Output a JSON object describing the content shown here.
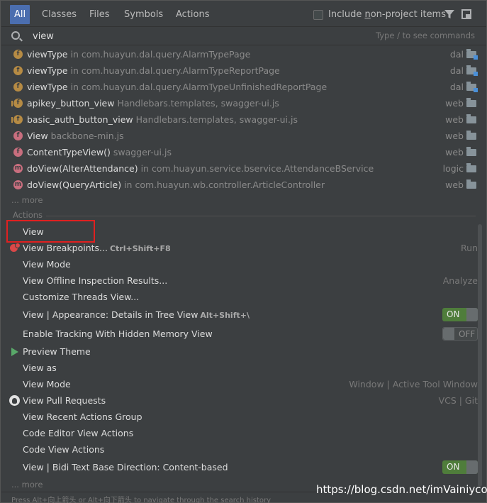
{
  "tabs": [
    {
      "label": "All",
      "active": true
    },
    {
      "label": "Classes"
    },
    {
      "label": "Files"
    },
    {
      "label": "Symbols"
    },
    {
      "label": "Actions"
    }
  ],
  "include_non_project": {
    "label_prefix": "Include ",
    "label_underlined": "n",
    "label_suffix": "on-project items",
    "checked": false
  },
  "search": {
    "value": "view",
    "hint": "Type / to see commands"
  },
  "results": [
    {
      "icon": "field",
      "name": "viewType",
      "location": "in com.huayun.dal.query.AlarmTypePage",
      "module": "dal"
    },
    {
      "icon": "field",
      "name": "viewType",
      "location": "in com.huayun.dal.query.AlarmTypeReportPage",
      "module": "dal"
    },
    {
      "icon": "field",
      "name": "viewType",
      "location": "in com.huayun.dal.query.AlarmTypeUnfinishedReportPage",
      "module": "dal"
    },
    {
      "icon": "function-local",
      "name": "apikey_button_view",
      "location": "Handlebars.templates, swagger-ui.js",
      "module": "web"
    },
    {
      "icon": "function-local",
      "name": "basic_auth_button_view",
      "location": "Handlebars.templates, swagger-ui.js",
      "module": "web"
    },
    {
      "icon": "function-param",
      "name": "View",
      "location": "backbone-min.js",
      "module": "web"
    },
    {
      "icon": "function-param",
      "name": "ContentTypeView()",
      "location": "swagger-ui.js",
      "module": "web"
    },
    {
      "icon": "method",
      "name": "doView(AlterAttendance)",
      "location": "in com.huayun.service.bservice.AttendanceBService",
      "module": "logic"
    },
    {
      "icon": "method",
      "name": "doView(QueryArticle)",
      "location": "in com.huayun.wb.controller.ArticleController",
      "module": "web"
    }
  ],
  "results_more": "... more",
  "actions_section_title": "Actions",
  "actions": [
    {
      "label": "View",
      "shortcut": "",
      "right": "",
      "icon": "",
      "toggle": ""
    },
    {
      "label": "View Breakpoints...",
      "shortcut": "Ctrl+Shift+F8",
      "right": "Run",
      "icon": "breakpoint",
      "toggle": ""
    },
    {
      "label": "View Mode",
      "shortcut": "",
      "right": "",
      "icon": "",
      "toggle": ""
    },
    {
      "label": "View Offline Inspection Results...",
      "shortcut": "",
      "right": "Analyze",
      "icon": "",
      "toggle": ""
    },
    {
      "label": "Customize Threads View...",
      "shortcut": "",
      "right": "",
      "icon": "",
      "toggle": ""
    },
    {
      "label": "View | Appearance: Details in Tree View",
      "shortcut": "Alt+Shift+\\",
      "right": "",
      "icon": "",
      "toggle": "ON"
    },
    {
      "label": "Enable Tracking With Hidden Memory View",
      "shortcut": "",
      "right": "",
      "icon": "",
      "toggle": "OFF"
    },
    {
      "label": "Preview Theme",
      "shortcut": "",
      "right": "",
      "icon": "play",
      "toggle": ""
    },
    {
      "label": "View as",
      "shortcut": "",
      "right": "",
      "icon": "",
      "toggle": ""
    },
    {
      "label": "View Mode",
      "shortcut": "",
      "right": "Window | Active Tool Window",
      "icon": "",
      "toggle": ""
    },
    {
      "label": "View Pull Requests",
      "shortcut": "",
      "right": "VCS | Git",
      "icon": "github",
      "toggle": ""
    },
    {
      "label": "View Recent Actions Group",
      "shortcut": "",
      "right": "",
      "icon": "",
      "toggle": ""
    },
    {
      "label": "Code Editor View Actions",
      "shortcut": "",
      "right": "",
      "icon": "",
      "toggle": ""
    },
    {
      "label": "Code View Actions",
      "shortcut": "",
      "right": "",
      "icon": "",
      "toggle": ""
    },
    {
      "label": "View | Bidi Text Base Direction: Content-based",
      "shortcut": "",
      "right": "",
      "icon": "",
      "toggle": "ON"
    }
  ],
  "actions_more": "... more",
  "footer_hint": "Press Alt+向上箭头 or Alt+向下箭头 to navigate through the search history",
  "watermark": "https://blog.csdn.net/imVainiycos",
  "colors": {
    "accent": "#4b6eaf",
    "highlight_box": "#e02020",
    "toggle_on": "#4f7d3b"
  }
}
